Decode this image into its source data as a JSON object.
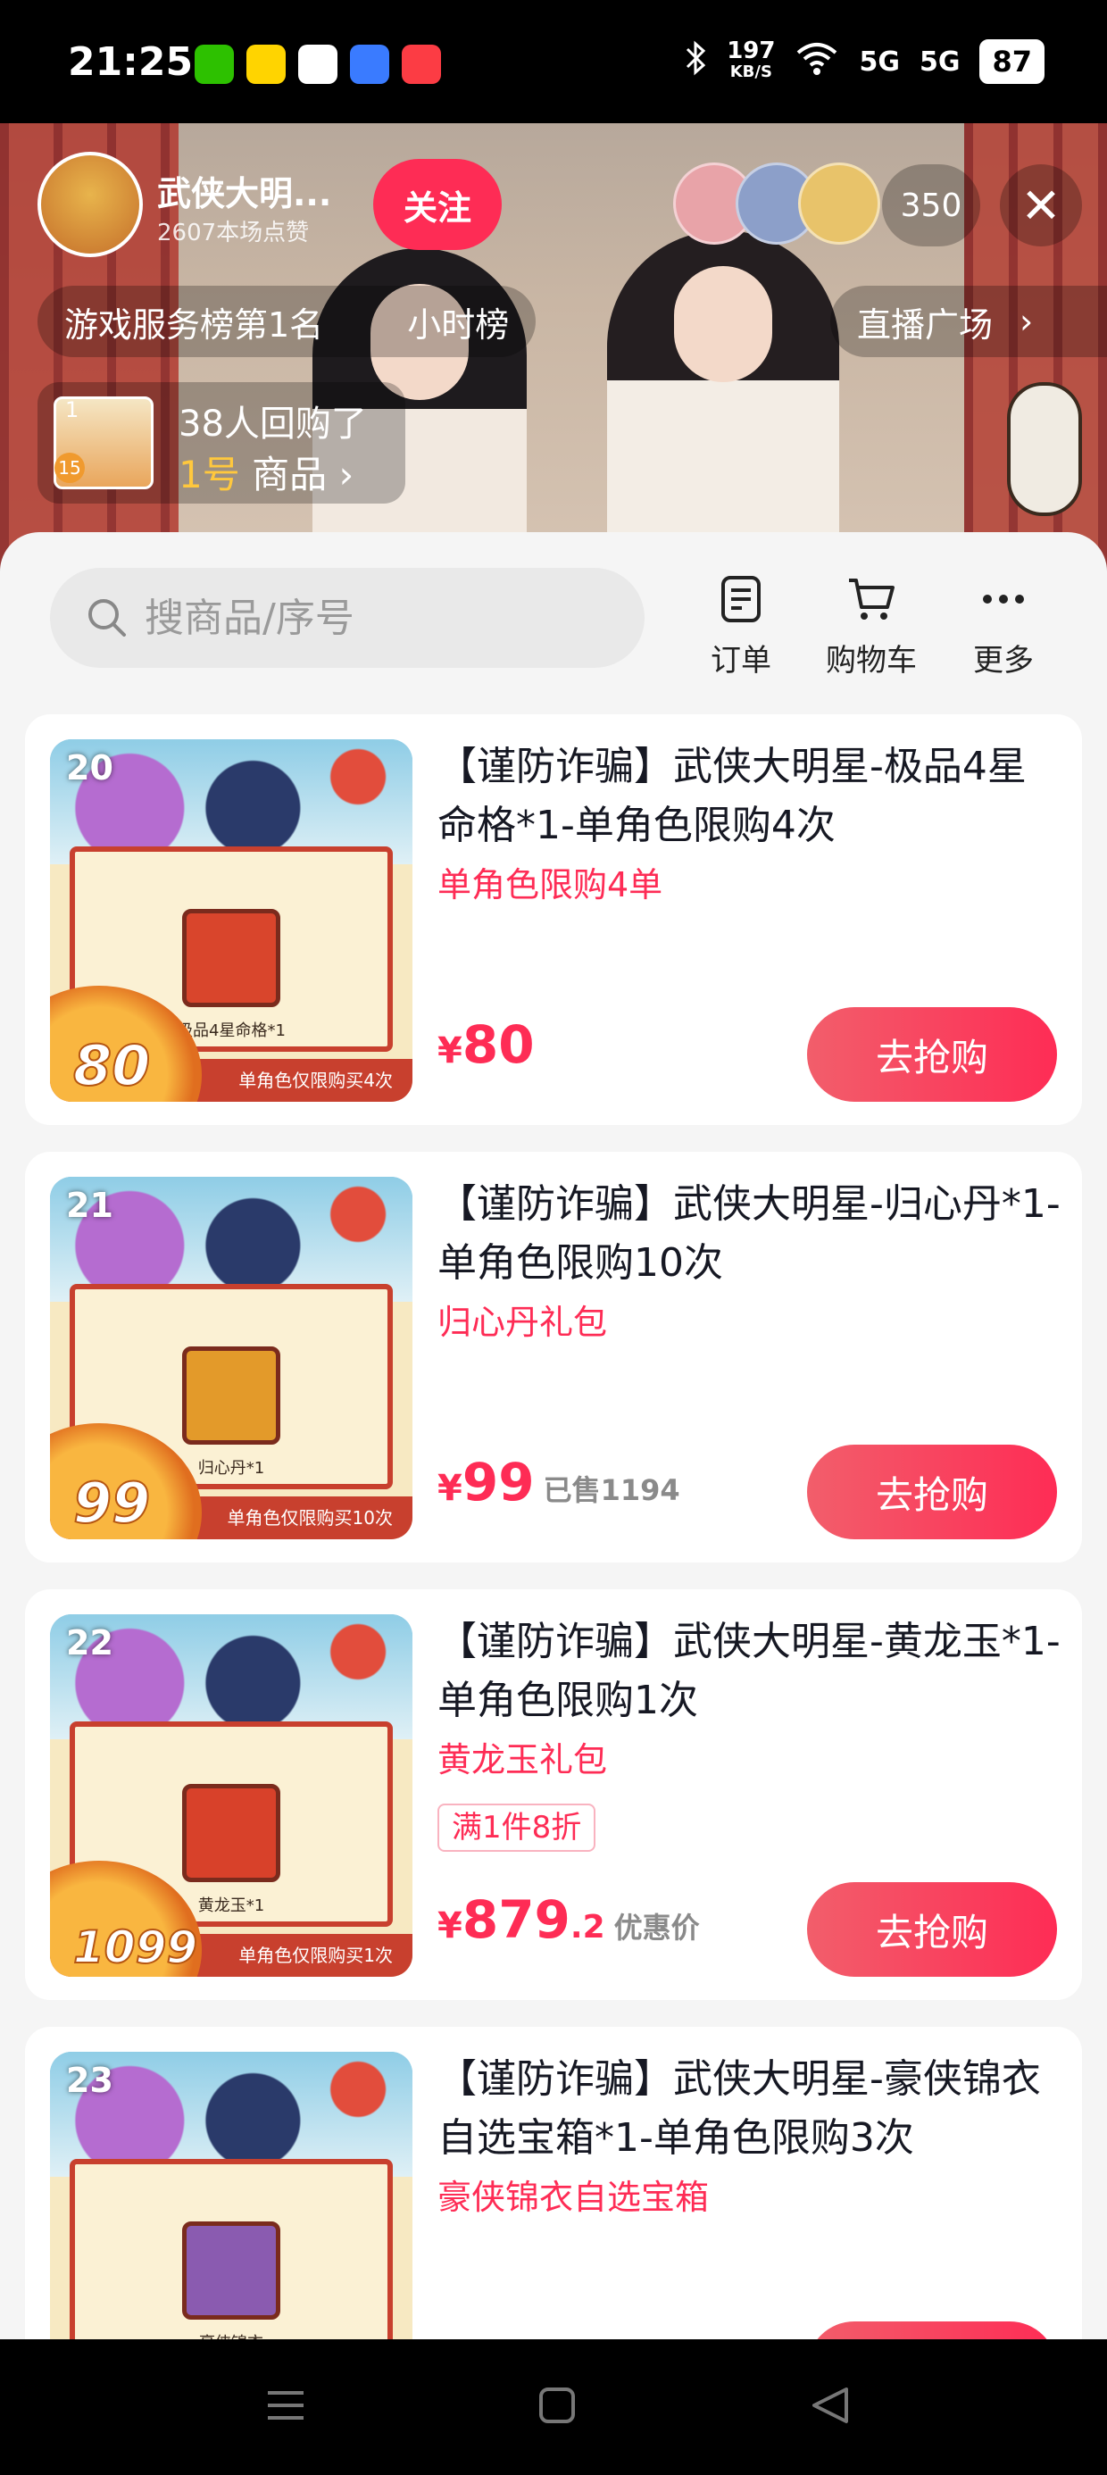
{
  "status_bar": {
    "time": "21:25",
    "speed_value": "197",
    "speed_unit": "KB/S",
    "net1": "5G",
    "net2": "5G",
    "battery": "87"
  },
  "live": {
    "anchor_name": "武侠大明...",
    "anchor_likes": "2607本场点赞",
    "follow_label": "关注",
    "viewer_count": "350",
    "close_icon": "close-icon",
    "rank_label": "游戏服务榜第1名",
    "rank_period": "小时榜",
    "plaza_label": "直播广场",
    "buy_badge_num": "1",
    "buy_badge_small": "15",
    "buy_line1": "38人回购了",
    "buy_item_num": "1号",
    "buy_item_label": "商品"
  },
  "sheet": {
    "search_placeholder": "搜商品/序号",
    "tools": [
      {
        "label": "订单",
        "icon": "order-icon"
      },
      {
        "label": "购物车",
        "icon": "cart-icon"
      },
      {
        "label": "更多",
        "icon": "more-icon"
      }
    ]
  },
  "products": [
    {
      "num": "20",
      "title": "【谨防诈骗】武侠大明星-极品4星命格*1-单角色限购4次",
      "subtitle": "单角色限购4单",
      "tag": "",
      "price_yen": "¥",
      "price_int": "80",
      "price_dec": "",
      "price_extra": "",
      "art_price": "80",
      "art_caption": "极品4星命格*1",
      "art_band": "单角色仅限购买4次",
      "button": "去抢购",
      "item_color": "#d9452c"
    },
    {
      "num": "21",
      "title": "【谨防诈骗】武侠大明星-归心丹*1-单角色限购10次",
      "subtitle": "归心丹礼包",
      "tag": "",
      "price_yen": "¥",
      "price_int": "99",
      "price_dec": "",
      "price_extra": "已售1194",
      "art_price": "99",
      "art_caption": "归心丹*1",
      "art_band": "单角色仅限购买10次",
      "button": "去抢购",
      "item_color": "#e39a2a"
    },
    {
      "num": "22",
      "title": "【谨防诈骗】武侠大明星-黄龙玉*1-单角色限购1次",
      "subtitle": "黄龙玉礼包",
      "tag": "满1件8折",
      "price_yen": "¥",
      "price_int": "879",
      "price_dec": ".2",
      "price_extra": "优惠价",
      "art_price": "1099",
      "art_caption": "黄龙玉*1",
      "art_band": "单角色仅限购买1次",
      "button": "去抢购",
      "item_color": "#d8412a"
    },
    {
      "num": "23",
      "title": "【谨防诈骗】武侠大明星-豪侠锦衣自选宝箱*1-单角色限购3次",
      "subtitle": "豪侠锦衣自选宝箱",
      "tag": "",
      "price_yen": "",
      "price_int": "",
      "price_dec": "",
      "price_extra": "",
      "art_price": "",
      "art_caption": "豪侠锦衣",
      "art_band": "",
      "button": "",
      "item_color": "#8a5bb0"
    }
  ],
  "colors": {
    "accent": "#fe2c55",
    "sheet_bg": "#f5f5f5"
  }
}
